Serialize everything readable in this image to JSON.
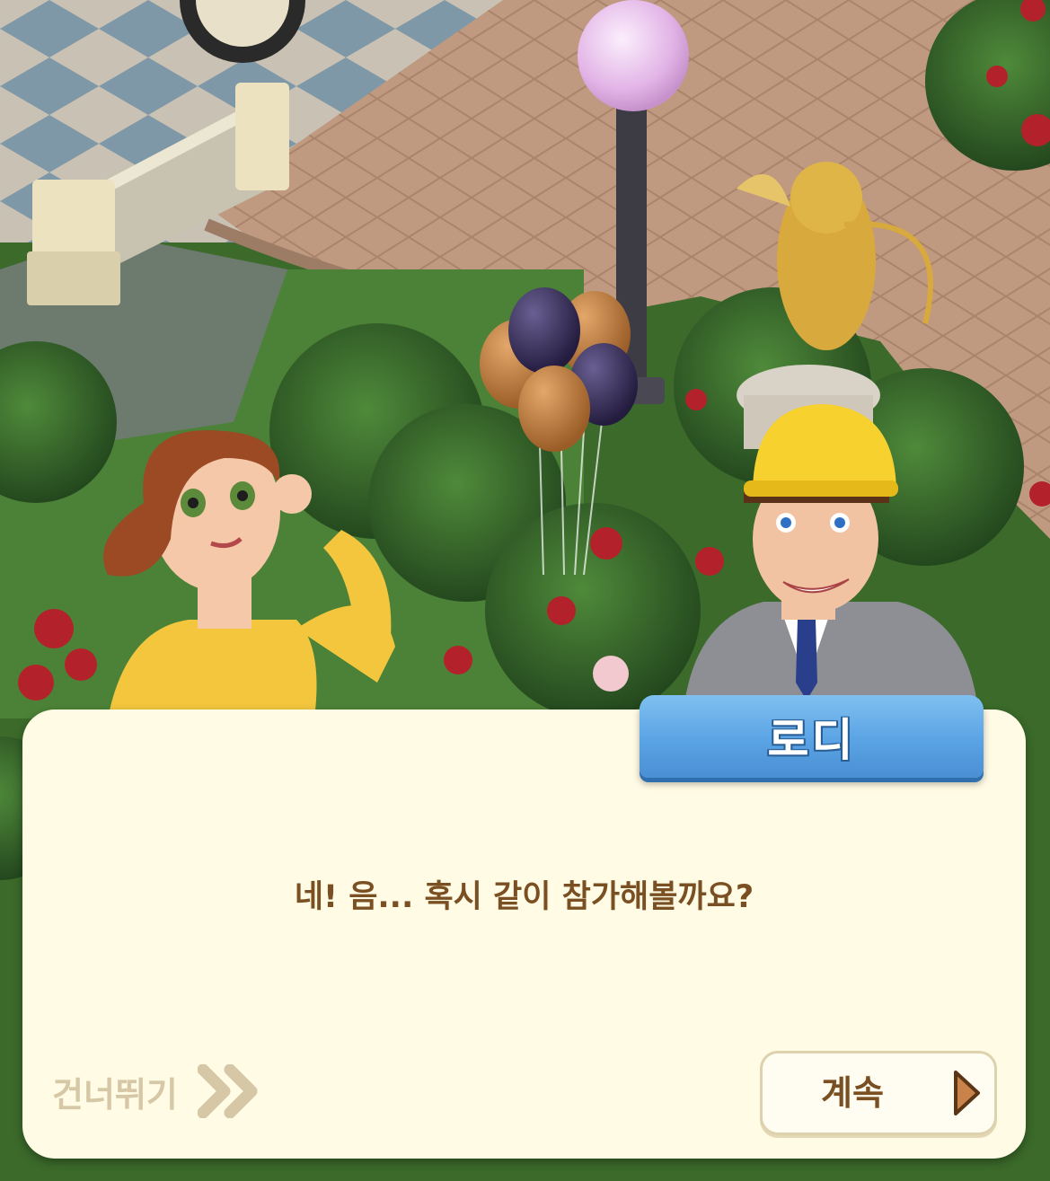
{
  "dialog": {
    "speaker_name": "로디",
    "line": "네! 음... 혹시 같이 참가해볼까요?"
  },
  "controls": {
    "skip_label": "건너뛰기",
    "skip_icon": "double-chevron-right-icon",
    "continue_label": "계속",
    "continue_icon": "play-triangle-icon"
  },
  "colors": {
    "dialog_background": "#fffbe5",
    "name_tag_blue": "#5aa3e4",
    "dialog_text": "#7a4f22",
    "skip_text": "#d6c8a6",
    "continue_arrow": "#c9834a"
  }
}
